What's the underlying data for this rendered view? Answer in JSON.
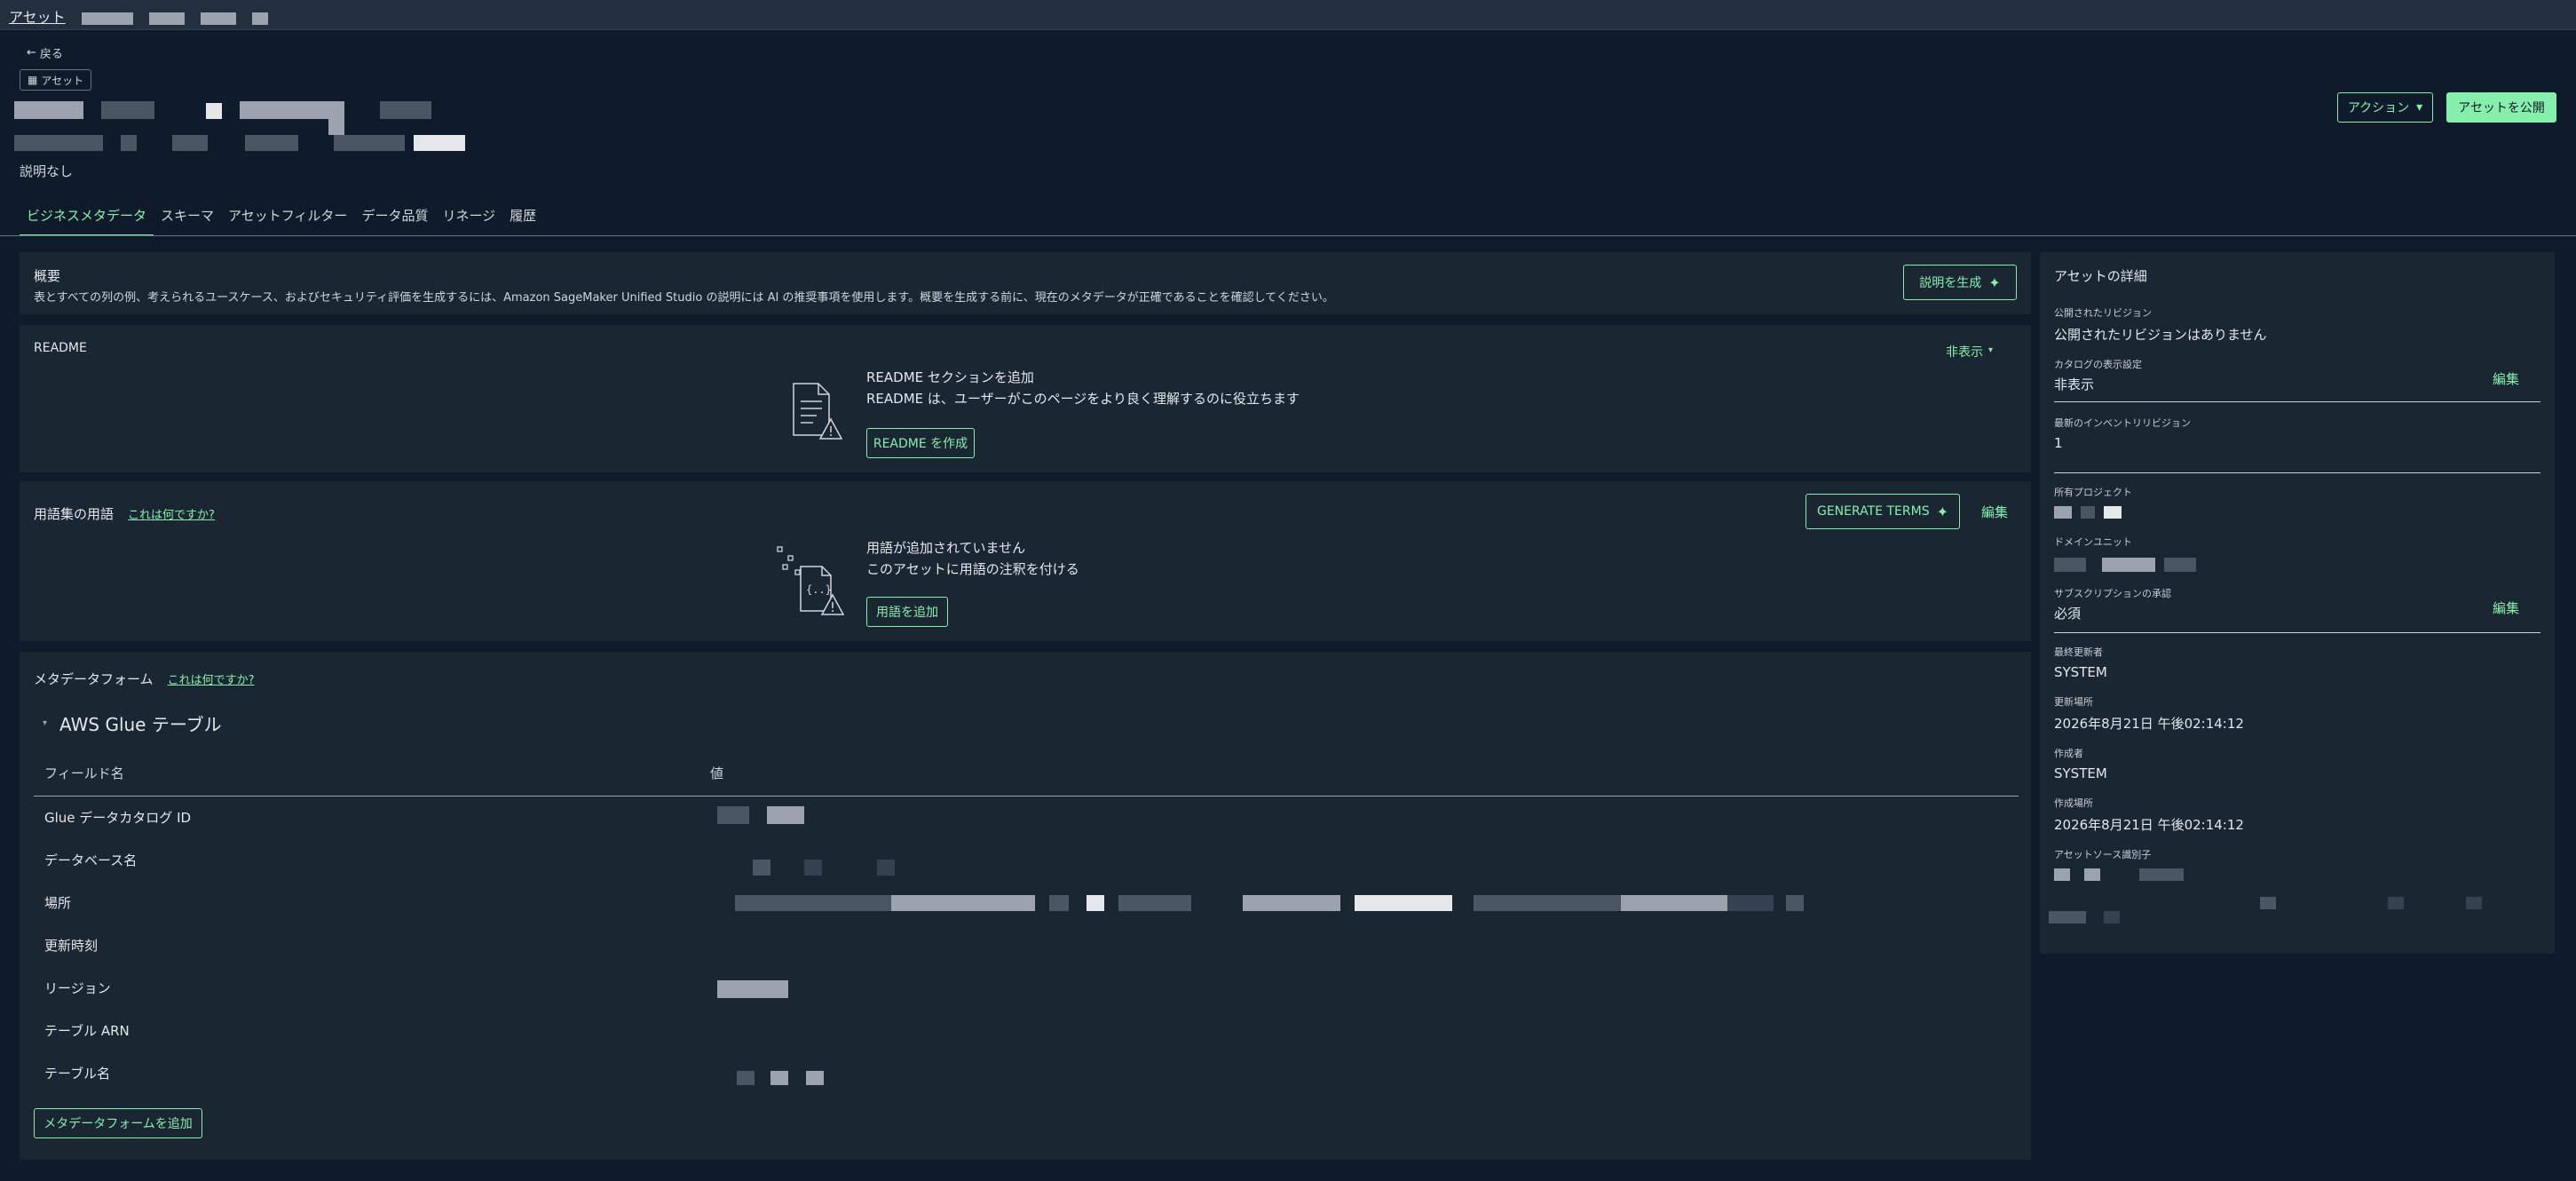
{
  "breadcrumb": {
    "root": "アセット"
  },
  "header": {
    "back_label": "戻る",
    "asset_badge": "アセット",
    "description": "説明なし",
    "actions_label": "アクション",
    "publish_label": "アセットを公開"
  },
  "tabs": [
    {
      "label": "ビジネスメタデータ",
      "active": true
    },
    {
      "label": "スキーマ",
      "active": false
    },
    {
      "label": "アセットフィルター",
      "active": false
    },
    {
      "label": "データ品質",
      "active": false
    },
    {
      "label": "リネージ",
      "active": false
    },
    {
      "label": "履歴",
      "active": false
    }
  ],
  "summary": {
    "title": "概要",
    "text": "表とすべての列の例、考えられるユースケース、およびセキュリティ評価を生成するには、Amazon SageMaker Unified Studio の説明には AI の推奨事項を使用します。概要を生成する前に、現在のメタデータが正確であることを確認してください。",
    "generate_label": "説明を生成"
  },
  "readme": {
    "title": "README",
    "hide_label": "非表示",
    "heading": "README セクションを追加",
    "subtext": "README は、ユーザーがこのページをより良く理解するのに役立ちます",
    "create_label": "README を作成"
  },
  "glossary": {
    "title": "用語集の用語",
    "what_link": "これは何ですか?",
    "generate_label": "GENERATE TERMS",
    "edit_label": "編集",
    "empty_heading": "用語が追加されていません",
    "empty_subtext": "このアセットに用語の注釈を付ける",
    "add_label": "用語を追加"
  },
  "metadata_forms": {
    "title": "メタデータフォーム",
    "what_link": "これは何ですか?",
    "form_title": "AWS Glue テーブル",
    "col_field": "フィールド名",
    "col_value": "値",
    "rows": [
      "Glue データカタログ ID",
      "データベース名",
      "場所",
      "更新時刻",
      "リージョン",
      "テーブル ARN",
      "テーブル名"
    ],
    "add_label": "メタデータフォームを追加"
  },
  "details": {
    "title": "アセットの詳細",
    "published_revision_label": "公開されたリビジョン",
    "published_revision_value": "公開されたリビジョンはありません",
    "catalog_visibility_label": "カタログの表示設定",
    "catalog_visibility_value": "非表示",
    "edit_label": "編集",
    "latest_inventory_label": "最新のインベントリリビジョン",
    "latest_inventory_value": "1",
    "owning_project_label": "所有プロジェクト",
    "domain_unit_label": "ドメインユニット",
    "subscription_label": "サブスクリプションの承認",
    "subscription_value": "必須",
    "last_updated_by_label": "最終更新者",
    "last_updated_by_value": "SYSTEM",
    "updated_at_label": "更新場所",
    "updated_at_value": "2026年8月21日 午後02:14:12",
    "created_by_label": "作成者",
    "created_by_value": "SYSTEM",
    "created_at_label": "作成場所",
    "created_at_value": "2026年8月21日 午後02:14:12",
    "source_id_label": "アセットソース識別子"
  }
}
